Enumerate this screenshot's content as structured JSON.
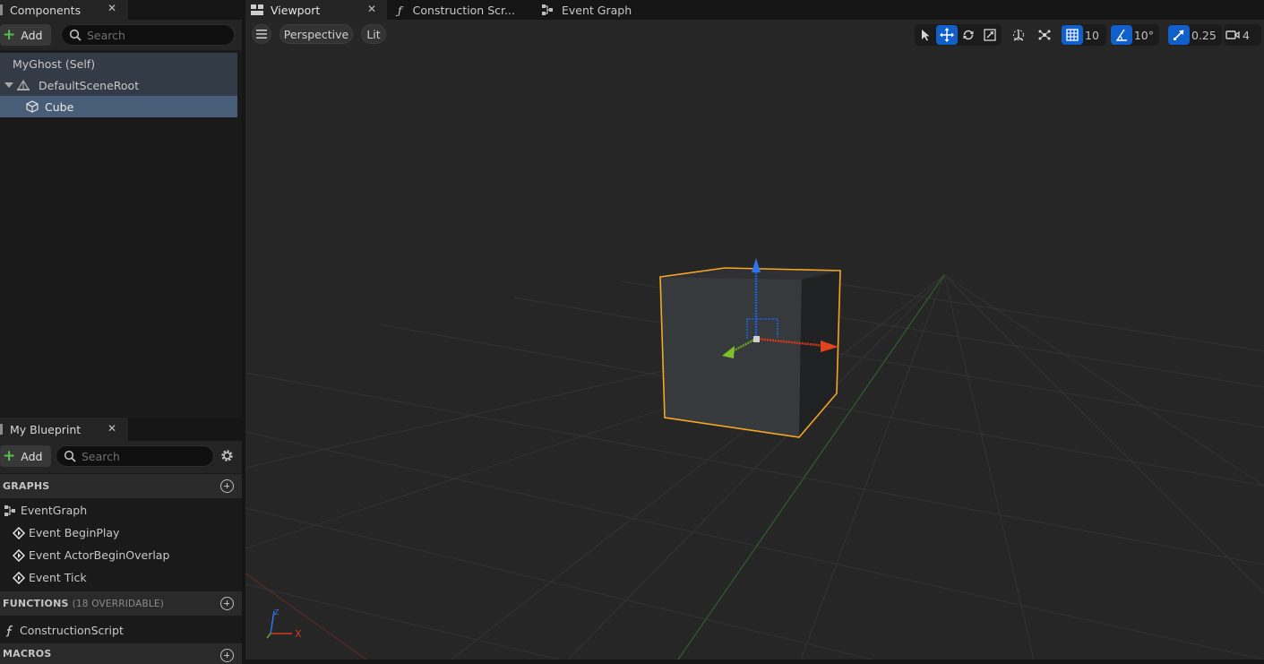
{
  "components_panel": {
    "tab_label": "Components",
    "add_label": "Add",
    "search_placeholder": "Search",
    "tree": {
      "root_label": "MyGhost (Self)",
      "scene_root_label": "DefaultSceneRoot",
      "child_label": "Cube"
    }
  },
  "blueprint_panel": {
    "tab_label": "My Blueprint",
    "add_label": "Add",
    "search_placeholder": "Search",
    "graphs_header": "GRAPHS",
    "event_graph_label": "EventGraph",
    "events": [
      "Event BeginPlay",
      "Event ActorBeginOverlap",
      "Event Tick"
    ],
    "functions_header": "FUNCTIONS",
    "functions_sub": "(18 OVERRIDABLE)",
    "construction_script_label": "ConstructionScript",
    "macros_header": "MACROS"
  },
  "document_tabs": {
    "viewport": "Viewport",
    "construction": "Construction Scr...",
    "event_graph": "Event Graph"
  },
  "viewport_toolbar": {
    "perspective_label": "Perspective",
    "lit_label": "Lit",
    "grid_snap_value": "10",
    "rotation_snap_value": "10°",
    "scale_snap_value": "0.25",
    "camera_speed_value": "4"
  },
  "axis_labels": {
    "x": "X",
    "z": "Z"
  },
  "colors": {
    "selection_outline": "#f5a623",
    "active_button": "#1160c9",
    "axis_x": "#d6391b",
    "axis_y": "#6aa81c",
    "axis_z": "#1e5fd6",
    "add_plus": "#57c04e"
  },
  "icons": [
    "hamburger-icon",
    "select-icon",
    "translate-icon",
    "rotate-icon",
    "scale-icon",
    "world-local-icon",
    "surface-snap-icon",
    "grid-icon",
    "angle-icon",
    "scale-snap-icon",
    "camera-icon",
    "gear-icon",
    "search-icon"
  ]
}
